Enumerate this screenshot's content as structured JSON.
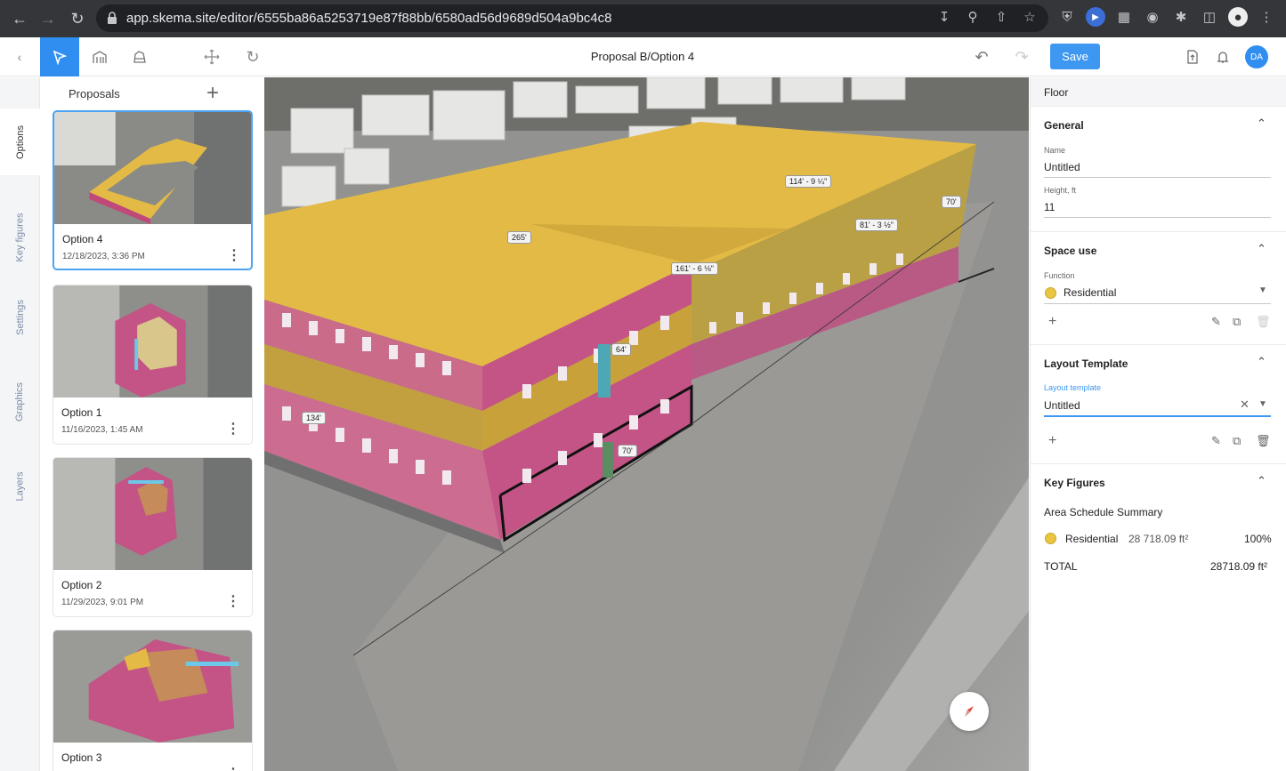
{
  "browser": {
    "url": "app.skema.site/editor/6555ba86a5253719e87f88bb/6580ad56d9689d504a9bc4c8"
  },
  "app": {
    "title": "Proposal B/Option 4",
    "save_label": "Save",
    "avatar_initials": "DA",
    "accent_color": "#3e97f0"
  },
  "side_tabs": [
    "Options",
    "Key figures",
    "Settings",
    "Graphics",
    "Layers"
  ],
  "proposals": {
    "heading": "Proposals",
    "cards": [
      {
        "name": "Option 4",
        "date": "12/18/2023, 3:36 PM"
      },
      {
        "name": "Option 1",
        "date": "11/16/2023, 1:45 AM"
      },
      {
        "name": "Option 2",
        "date": "11/29/2023, 9:01 PM"
      },
      {
        "name": "Option 3",
        "date": ""
      }
    ]
  },
  "viewport": {
    "dimensions": [
      "265'",
      "114' - 9 ¼\"",
      "70'",
      "81' - 3 ½\"",
      "161' - 6 ⅛\"",
      "64'",
      "134'",
      "70'"
    ]
  },
  "panel": {
    "title": "Floor",
    "general": {
      "heading": "General",
      "name_label": "Name",
      "name_value": "Untitled",
      "height_label": "Height, ft",
      "height_value": "11"
    },
    "space_use": {
      "heading": "Space use",
      "function_label": "Function",
      "function_value": "Residential",
      "residential_color": "#e9c542"
    },
    "layout_template": {
      "heading": "Layout Template",
      "label": "Layout template",
      "value": "Untitled"
    },
    "key_figures": {
      "heading": "Key Figures",
      "subheading": "Area Schedule Summary",
      "rows": [
        {
          "name": "Residential",
          "area": "28 718.09 ft²",
          "percent": "100%"
        }
      ],
      "total_label": "TOTAL",
      "total_value": "28718.09 ft²"
    }
  }
}
